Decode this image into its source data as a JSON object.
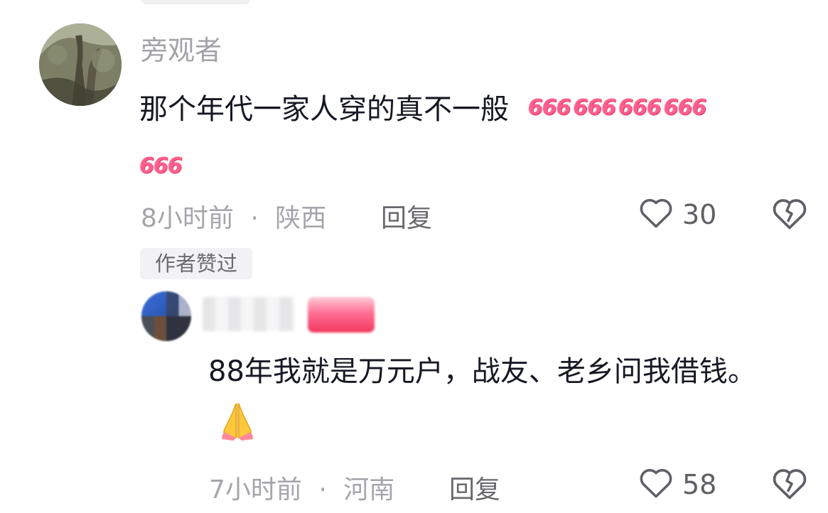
{
  "comments": [
    {
      "username": "旁观者",
      "text": "那个年代一家人穿的真不一般",
      "emoji_text": "666",
      "emoji_count": 5,
      "time": "8小时前",
      "separator": "·",
      "location": "陕西",
      "reply_label": "回复",
      "like_count": "30"
    }
  ],
  "badge": {
    "label": "作者赞过"
  },
  "reply": {
    "text": "88年我就是万元户，战友、老乡问我借钱。",
    "emoji_icon": "praying-hands-icon",
    "time": "7小时前",
    "separator": "·",
    "location": "河南",
    "reply_label": "回复",
    "like_count": "58"
  },
  "colors": {
    "text_primary": "#161823",
    "text_secondary": "#a5a6ab",
    "emoji_pink": "#ff5f8c",
    "tag_red": "#f2365e"
  }
}
